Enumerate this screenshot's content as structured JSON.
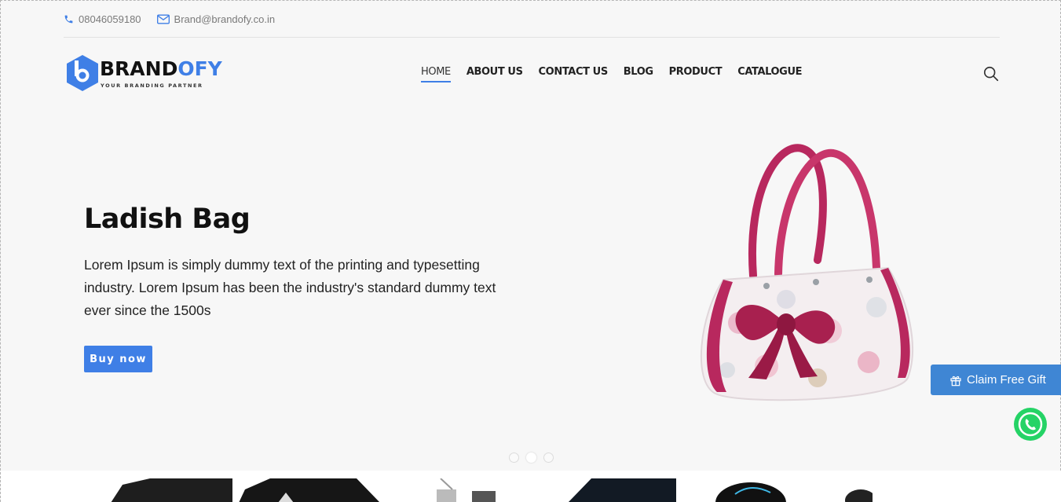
{
  "topbar": {
    "phone": "08046059180",
    "email": "Brand@brandofy.co.in"
  },
  "logo": {
    "name_dark": "BRAND",
    "name_accent": "OFY",
    "tagline": "YOUR BRANDING PARTNER"
  },
  "nav": {
    "items": [
      {
        "label": "HOME",
        "active": true
      },
      {
        "label": "ABOUT US"
      },
      {
        "label": "CONTACT US"
      },
      {
        "label": "BLOG"
      },
      {
        "label": "PRODUCT"
      },
      {
        "label": "CATALOGUE"
      }
    ]
  },
  "hero": {
    "title": "Ladish Bag",
    "description": "Lorem Ipsum is simply dummy text of the printing and typesetting industry. Lorem Ipsum has been the industry's standard dummy text ever since the 1500s",
    "button_label": "Buy now",
    "slide_count": 3,
    "active_slide": 2
  },
  "floating": {
    "gift_label": "Claim Free Gift"
  },
  "colors": {
    "accent": "#3f7fe6",
    "gift": "#3f86d4",
    "whatsapp": "#25d366"
  },
  "icons": [
    "phone-icon",
    "mail-icon",
    "search-icon",
    "gift-icon",
    "whatsapp-icon"
  ]
}
